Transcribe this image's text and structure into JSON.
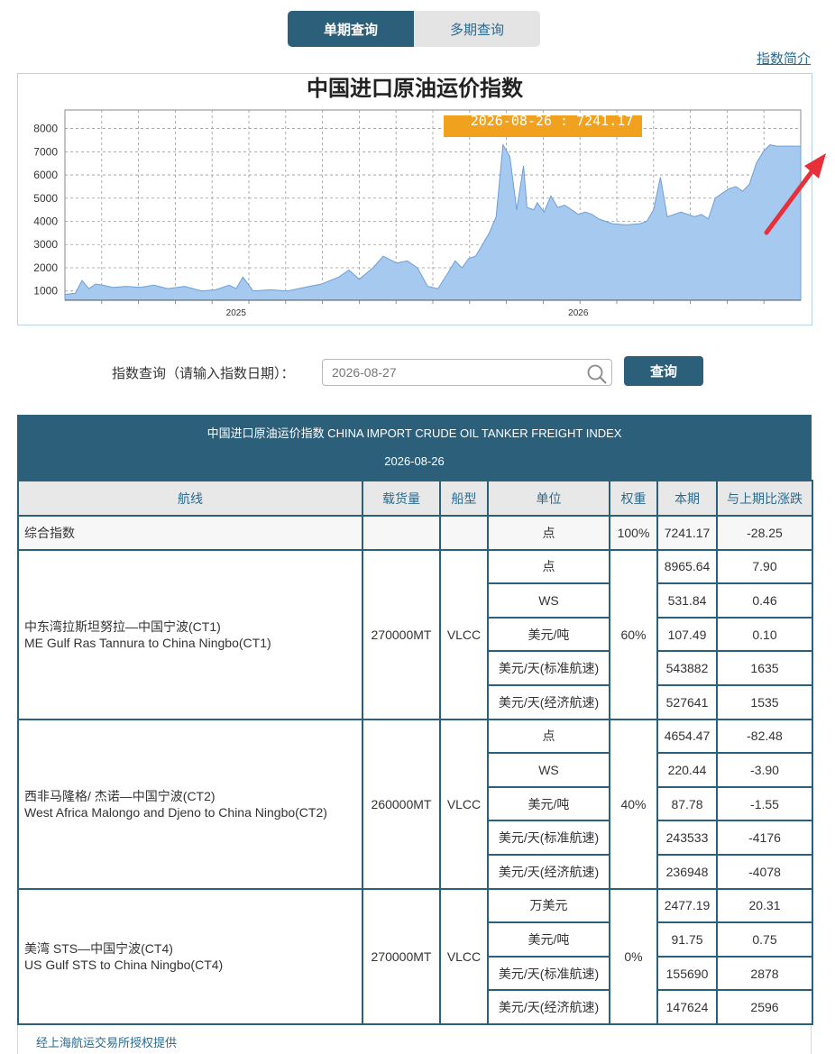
{
  "tabs": {
    "single": "单期查询",
    "multi": "多期查询"
  },
  "intro_link": "指数简介",
  "chart_data": {
    "type": "area",
    "title": "中国进口原油运价指数",
    "tooltip": "2026-08-26 : 7241.17",
    "y_ticks": [
      1000,
      2000,
      3000,
      4000,
      5000,
      6000,
      7000,
      8000
    ],
    "ylim": [
      600,
      8800
    ],
    "x_tick_labels": [
      {
        "label": "2025",
        "x": 2025.0
      },
      {
        "label": "2026",
        "x": 2026.0
      }
    ],
    "xlim": [
      2024.5,
      2026.65
    ],
    "grid": true,
    "series": [
      {
        "x": [
          2024.5,
          2024.53,
          2024.55,
          2024.57,
          2024.59,
          2024.61,
          2024.64,
          2024.68,
          2024.72,
          2024.76,
          2024.8,
          2024.85,
          2024.9,
          2024.94,
          2024.98,
          2025.0,
          2025.02,
          2025.05,
          2025.1,
          2025.15,
          2025.2,
          2025.25,
          2025.3,
          2025.33,
          2025.36,
          2025.4,
          2025.43,
          2025.47,
          2025.5,
          2025.53,
          2025.56,
          2025.59,
          2025.62,
          2025.64,
          2025.66,
          2025.68,
          2025.7,
          2025.72,
          2025.74,
          2025.76,
          2025.78,
          2025.8,
          2025.82,
          2025.84,
          2025.85,
          2025.87,
          2025.88,
          2025.9,
          2025.92,
          2025.94,
          2025.96,
          2025.98,
          2026.0,
          2026.02,
          2026.04,
          2026.06,
          2026.1,
          2026.14,
          2026.18,
          2026.2,
          2026.22,
          2026.24,
          2026.26,
          2026.28,
          2026.3,
          2026.32,
          2026.34,
          2026.36,
          2026.38,
          2026.4,
          2026.42,
          2026.44,
          2026.46,
          2026.48,
          2026.5,
          2026.52,
          2026.54,
          2026.56,
          2026.58,
          2026.6,
          2026.62,
          2026.63,
          2026.64,
          2026.65
        ],
        "y": [
          850,
          900,
          1450,
          1100,
          1300,
          1250,
          1150,
          1200,
          1150,
          1250,
          1100,
          1200,
          1000,
          1050,
          1250,
          1100,
          1600,
          1000,
          1050,
          1000,
          1150,
          1300,
          1600,
          1900,
          1500,
          2000,
          2500,
          2200,
          2300,
          2000,
          1200,
          1100,
          1800,
          2300,
          2000,
          2400,
          2500,
          3000,
          3500,
          4200,
          7300,
          6800,
          4500,
          6400,
          4600,
          4500,
          4800,
          4400,
          5100,
          4600,
          4700,
          4500,
          4300,
          4400,
          4300,
          4100,
          3900,
          3850,
          3900,
          4000,
          4500,
          5900,
          4200,
          4300,
          4400,
          4300,
          4200,
          4300,
          4100,
          5000,
          5200,
          5400,
          5500,
          5300,
          5600,
          6500,
          7000,
          7300,
          7241,
          7241,
          7241,
          7241,
          7241,
          7241
        ]
      }
    ]
  },
  "query": {
    "label": "指数查询（请输入指数日期）：",
    "value": "2026-08-27",
    "button": "查询"
  },
  "table": {
    "title": "中国进口原油运价指数 CHINA IMPORT CRUDE OIL TANKER FREIGHT INDEX",
    "date": "2026-08-26",
    "headers": [
      "航线",
      "载货量",
      "船型",
      "单位",
      "权重",
      "本期",
      "与上期比涨跌"
    ],
    "composite": {
      "route": "综合指数",
      "unit": "点",
      "weight": "100%",
      "current": "7241.17",
      "change": "-28.25"
    },
    "routes": [
      {
        "name_cn": "中东湾拉斯坦努拉—中国宁波(CT1)",
        "name_en": "ME Gulf Ras Tannura to China Ningbo(CT1)",
        "cargo": "270000MT",
        "ship": "VLCC",
        "weight": "60%",
        "rows": [
          {
            "unit": "点",
            "current": "8965.64",
            "change": "7.90"
          },
          {
            "unit": "WS",
            "current": "531.84",
            "change": "0.46"
          },
          {
            "unit": "美元/吨",
            "current": "107.49",
            "change": "0.10"
          },
          {
            "unit": "美元/天(标准航速)",
            "current": "543882",
            "change": "1635"
          },
          {
            "unit": "美元/天(经济航速)",
            "current": "527641",
            "change": "1535"
          }
        ]
      },
      {
        "name_cn": "西非马隆格/ 杰诺—中国宁波(CT2)",
        "name_en": "West Africa Malongo and Djeno to China Ningbo(CT2)",
        "cargo": "260000MT",
        "ship": "VLCC",
        "weight": "40%",
        "rows": [
          {
            "unit": "点",
            "current": "4654.47",
            "change": "-82.48"
          },
          {
            "unit": "WS",
            "current": "220.44",
            "change": "-3.90"
          },
          {
            "unit": "美元/吨",
            "current": "87.78",
            "change": "-1.55"
          },
          {
            "unit": "美元/天(标准航速)",
            "current": "243533",
            "change": "-4176"
          },
          {
            "unit": "美元/天(经济航速)",
            "current": "236948",
            "change": "-4078"
          }
        ]
      },
      {
        "name_cn": "美湾 STS—中国宁波(CT4)",
        "name_en": "US Gulf STS to China Ningbo(CT4)",
        "cargo": "270000MT",
        "ship": "VLCC",
        "weight": "0%",
        "rows": [
          {
            "unit": "万美元",
            "current": "2477.19",
            "change": "20.31"
          },
          {
            "unit": "美元/吨",
            "current": "91.75",
            "change": "0.75"
          },
          {
            "unit": "美元/天(标准航速)",
            "current": "155690",
            "change": "2878"
          },
          {
            "unit": "美元/天(经济航速)",
            "current": "147624",
            "change": "2596"
          }
        ]
      }
    ]
  },
  "footer": "经上海航运交易所授权提供",
  "colors": {
    "primary": "#2b5f7a",
    "area_fill": "#a6c9ef",
    "area_stroke": "#6e9fd6",
    "tooltip": "#f0a21e",
    "arrow": "#e8303a"
  }
}
